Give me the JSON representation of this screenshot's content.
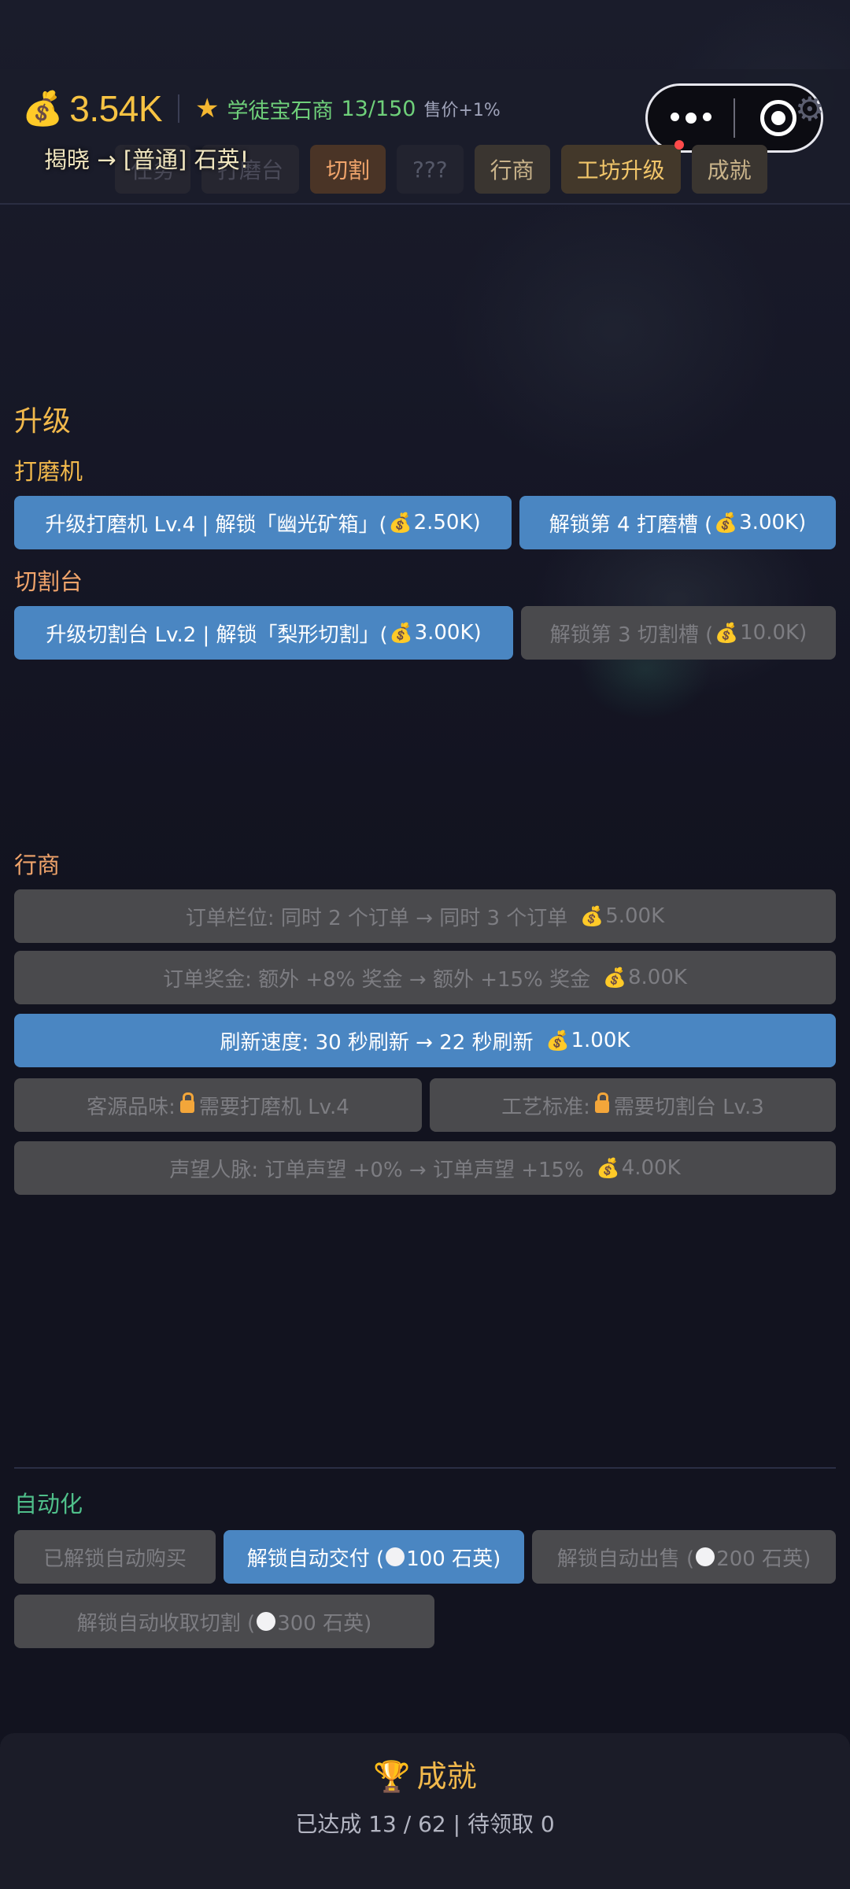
{
  "header": {
    "money": "3.54K",
    "rank_name": "学徒宝石商",
    "rank_count": "13/150",
    "rank_bonus": "售价+1%",
    "reveal_text": "揭晓 → [普通] 石英!"
  },
  "tabs": [
    {
      "label": "任务",
      "state": "dim"
    },
    {
      "label": "打磨台",
      "state": "dim"
    },
    {
      "label": "切割",
      "state": "active"
    },
    {
      "label": "???",
      "state": "locked"
    },
    {
      "label": "行商",
      "state": "normal"
    },
    {
      "label": "工坊升级",
      "state": "gold",
      "badge": true
    },
    {
      "label": "成就",
      "state": "normal"
    }
  ],
  "upgrade": {
    "title": "升级",
    "grinder": {
      "title": "打磨机",
      "upgrade_btn": {
        "text": "升级打磨机 Lv.4 | 解锁「幽光矿箱」(",
        "price": "2.50K)"
      },
      "slot_btn": {
        "text": "解锁第 4 打磨槽 (",
        "price": "3.00K)"
      }
    },
    "cutter": {
      "title": "切割台",
      "upgrade_btn": {
        "text": "升级切割台 Lv.2 | 解锁「梨形切割」(",
        "price": "3.00K)"
      },
      "slot_btn": {
        "text": "解锁第 3 切割槽 (",
        "price": "10.0K)"
      }
    }
  },
  "merchant": {
    "title": "行商",
    "order_slots": {
      "text": "订单栏位: 同时 2 个订单 → 同时 3 个订单",
      "price": "5.00K"
    },
    "order_bonus": {
      "text": "订单奖金: 额外 +8% 奖金 → 额外 +15% 奖金",
      "price": "8.00K"
    },
    "refresh": {
      "text": "刷新速度: 30 秒刷新 → 22 秒刷新",
      "price": "1.00K"
    },
    "client_taste": {
      "label": "客源品味:",
      "req": "需要打磨机 Lv.4"
    },
    "craft_std": {
      "label": "工艺标准:",
      "req": "需要切割台 Lv.3"
    },
    "reputation": {
      "text": "声望人脉: 订单声望 +0% → 订单声望 +15%",
      "price": "4.00K"
    }
  },
  "automation": {
    "title": "自动化",
    "auto_buy": "已解锁自动购买",
    "auto_deliver": {
      "text": "解锁自动交付 (",
      "cost": "100 石英)"
    },
    "auto_sell": {
      "text": "解锁自动出售 (",
      "cost": "200 石英)"
    },
    "auto_collect": {
      "text": "解锁自动收取切割 (",
      "cost": "300 石英)"
    }
  },
  "achievements": {
    "title": "成就",
    "stats": "已达成 13 / 62 | 待领取 0"
  },
  "colors": {
    "accent_gold": "#f2b94c",
    "button_blue": "#4a86c2",
    "button_gray": "#4a4a4d",
    "rank_green": "#6fd07a",
    "automation_green": "#4fbf8a"
  }
}
